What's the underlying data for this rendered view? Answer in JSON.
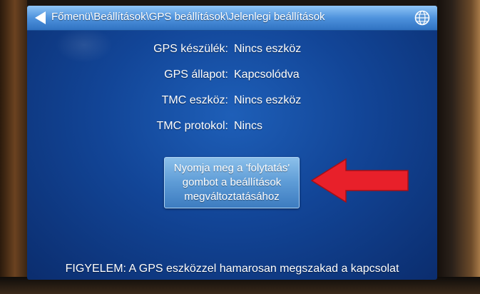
{
  "titlebar": {
    "breadcrumb": "Főmenü\\Beállítások\\GPS beállítások\\Jelenlegi beállítások",
    "back_icon": "back-arrow-icon",
    "globe_icon": "globe-icon"
  },
  "info": {
    "rows": [
      {
        "label": "GPS készülék:",
        "value": "Nincs eszköz"
      },
      {
        "label": "GPS állapot:",
        "value": "Kapcsolódva"
      },
      {
        "label": "TMC eszköz:",
        "value": "Nincs eszköz"
      },
      {
        "label": "TMC protokol:",
        "value": "Nincs"
      }
    ]
  },
  "continue_button": {
    "label": "Nyomja meg a 'folytatás' gombot a beállítások megváltoztatásához"
  },
  "warning": {
    "text": "FIGYELEM: A GPS eszközzel  hamarosan megszakad a kapcsolat"
  },
  "colors": {
    "screen_bg": "#124597",
    "titlebar": "#4f93dd",
    "button": "#5d9bd6",
    "annotation_arrow": "#e8202a"
  }
}
